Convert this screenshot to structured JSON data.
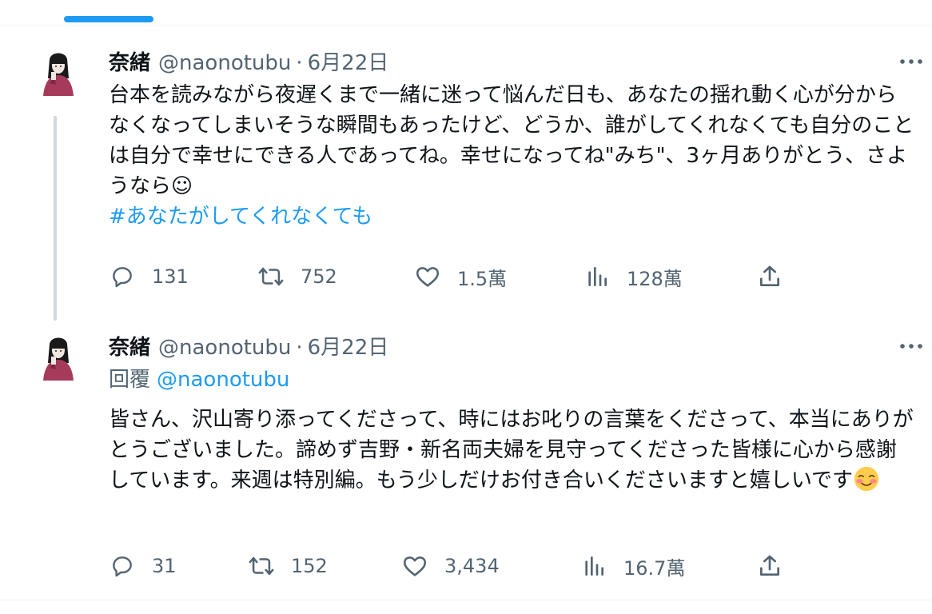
{
  "tweets": [
    {
      "name": "奈緒",
      "handle": "@naonotubu",
      "separator": "·",
      "date": "6月22日",
      "text": "台本を読みながら夜遅くまで一緒に迷って悩んだ日も、あなたの揺れ動く心が分からなくなってしまいそうな瞬間もあったけど、どうか、誰がしてくれなくても自分のことは自分で幸せにできる人であってね。幸せになってね\"みち\"、3ヶ月ありがとう、さようなら☺",
      "hashtag": "#あなたがしてくれなくても",
      "replies": "131",
      "retweets": "752",
      "likes": "1.5萬",
      "views": "128萬"
    },
    {
      "name": "奈緒",
      "handle": "@naonotubu",
      "separator": "·",
      "date": "6月22日",
      "reply_label": "回覆",
      "reply_to": "@naonotubu",
      "text": "皆さん、沢山寄り添ってくださって、時にはお叱りの言葉をくださって、本当にありがとうございました。諦めず吉野・新名両夫婦を見守ってくださった皆様に心から感謝しています。来週は特別編。もう少しだけお付き合いくださいますと嬉しいです",
      "replies": "31",
      "retweets": "152",
      "likes": "3,434",
      "views": "16.7萬"
    }
  ],
  "icons": {
    "reply": "reply-icon",
    "retweet": "retweet-icon",
    "like": "heart-icon",
    "views": "views-icon",
    "share": "share-icon",
    "more": "more-icon"
  },
  "colors": {
    "accent": "#1d9bf0",
    "secondary_text": "#536471",
    "thread_line": "#cfd9de",
    "divider": "#eff3f4"
  }
}
